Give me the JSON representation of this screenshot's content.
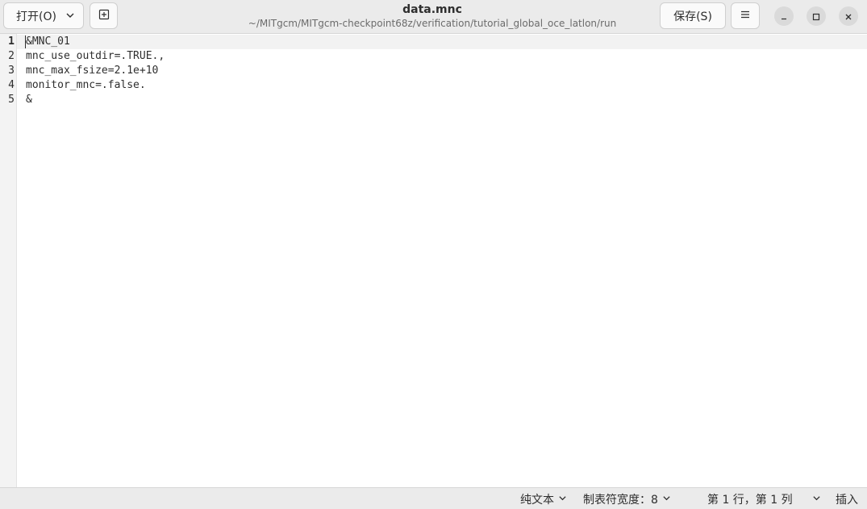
{
  "header": {
    "open_label": "打开(O)",
    "title": "data.mnc",
    "subtitle": "~/MITgcm/MITgcm-checkpoint68z/verification/tutorial_global_oce_latlon/run",
    "save_label": "保存(S)",
    "icons": {
      "open_menu": "chevron-down-icon",
      "new_tab": "new-tab-icon",
      "main_menu": "hamburger-menu-icon",
      "minimize": "minimize-icon",
      "maximize": "maximize-icon",
      "close": "close-icon"
    }
  },
  "editor": {
    "current_line": 1,
    "lines": [
      {
        "number": "1",
        "text": "&MNC_01"
      },
      {
        "number": "2",
        "text": "mnc_use_outdir=.TRUE.,"
      },
      {
        "number": "3",
        "text": "mnc_max_fsize=2.1e+10"
      },
      {
        "number": "4",
        "text": "monitor_mnc=.false."
      },
      {
        "number": "5",
        "text": "&"
      }
    ]
  },
  "statusbar": {
    "language": "纯文本",
    "tab_width": "制表符宽度：8",
    "position": "第 1 行，第 1 列",
    "mode": "插入"
  },
  "colors": {
    "header_bg": "#ebebeb",
    "editor_bg": "#ffffff",
    "current_line_bg": "#f2f2f2",
    "text": "#2e2e2e",
    "subtitle": "#6b6b6b"
  }
}
